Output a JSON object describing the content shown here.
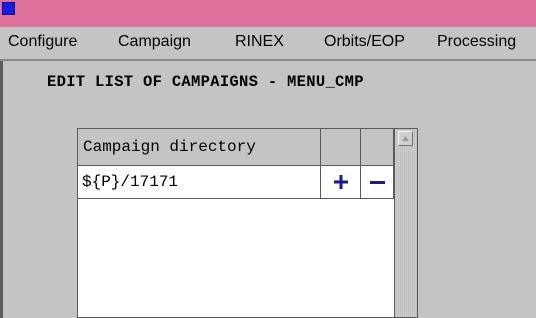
{
  "window": {
    "icon": "app-icon",
    "accent_color": "#e0739e"
  },
  "menubar": {
    "items": [
      {
        "label": "Configure"
      },
      {
        "label": "Campaign"
      },
      {
        "label": "RINEX"
      },
      {
        "label": "Orbits/EOP"
      },
      {
        "label": "Processing"
      }
    ]
  },
  "page": {
    "title": "EDIT LIST OF CAMPAIGNS - MENU_CMP"
  },
  "table": {
    "header": {
      "column_label": "Campaign directory"
    },
    "rows": [
      {
        "directory": "${P}/17171",
        "add_icon": "plus-icon",
        "remove_icon": "minus-icon"
      }
    ],
    "button_color": "#1a1a8c"
  }
}
